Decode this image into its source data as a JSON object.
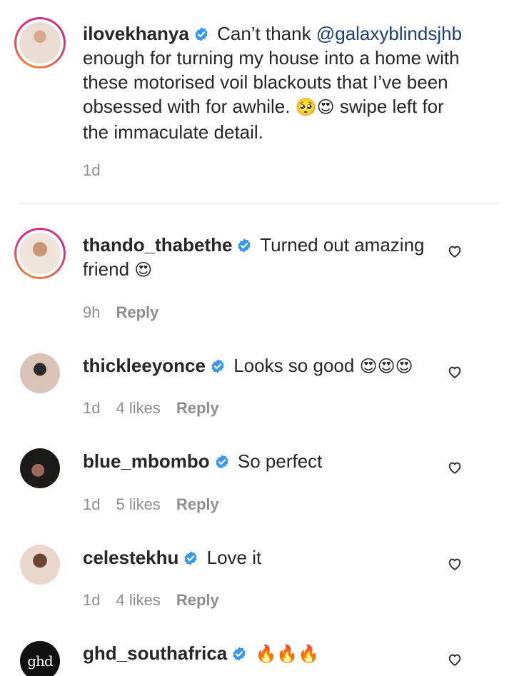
{
  "caption": {
    "username": "ilovekhanya",
    "text_before": " Can’t thank ",
    "mention": "@galaxyblindsjhb",
    "text_after": " enough for turning my house into a home with these motorised voil blackouts that I’ve been obsessed with for awhile. ",
    "emojis": "🥺😍",
    "text_end": " swipe left for the immaculate detail.",
    "time": "1d"
  },
  "comments": [
    {
      "username": "thando_thabethe",
      "text": " Turned out amazing friend ",
      "emoji": "😍",
      "time": "9h",
      "likes": "",
      "reply": "Reply"
    },
    {
      "username": "thickleeyonce",
      "text": " Looks so good ",
      "emoji": "😍😍😍",
      "time": "1d",
      "likes": "4 likes",
      "reply": "Reply"
    },
    {
      "username": "blue_mbombo",
      "text": " So perfect",
      "emoji": "",
      "time": "1d",
      "likes": "5 likes",
      "reply": "Reply"
    },
    {
      "username": "celestekhu",
      "text": " Love it",
      "emoji": "",
      "time": "1d",
      "likes": "4 likes",
      "reply": "Reply"
    },
    {
      "username": "ghd_southafrica",
      "text": " ",
      "emoji": "🔥🔥🔥",
      "time": "",
      "likes": "",
      "reply": ""
    }
  ],
  "ghd_logo": "ghd",
  "colors": {
    "verified": "#3897f0",
    "mention": "#1d3d75",
    "meta": "#8e8e8e"
  }
}
